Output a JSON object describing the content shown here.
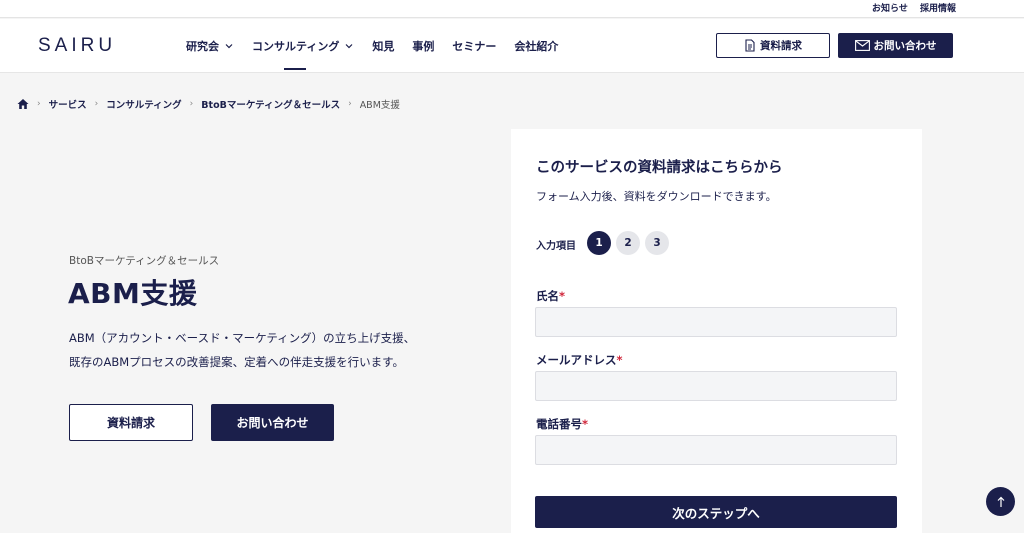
{
  "utility": {
    "news": "お知らせ",
    "recruit": "採用情報"
  },
  "header": {
    "logo": "SAIRU",
    "nav": [
      {
        "label": "研究会",
        "has_dropdown": true
      },
      {
        "label": "コンサルティング",
        "has_dropdown": true
      },
      {
        "label": "知見",
        "has_dropdown": false
      },
      {
        "label": "事例",
        "has_dropdown": false
      },
      {
        "label": "セミナー",
        "has_dropdown": false
      },
      {
        "label": "会社紹介",
        "has_dropdown": false
      }
    ],
    "doc_button": "資料請求",
    "contact_button": "お問い合わせ"
  },
  "breadcrumb": {
    "items": [
      "サービス",
      "コンサルティング",
      "BtoBマーケティング＆セールス"
    ],
    "current": "ABM支援"
  },
  "hero": {
    "category": "BtoBマーケティング＆セールス",
    "title": "ABM支援",
    "description_line1": "ABM（アカウント・ベースド・マーケティング）の立ち上げ支援、",
    "description_line2": "既存のABMプロセスの改善提案、定着への伴走支援を行います。",
    "doc_button": "資料請求",
    "contact_button": "お問い合わせ"
  },
  "form": {
    "title": "このサービスの資料請求はこちらから",
    "subtitle": "フォーム入力後、資料をダウンロードできます。",
    "steps_label": "入力項目",
    "steps": [
      "1",
      "2",
      "3"
    ],
    "current_step": 1,
    "fields": [
      {
        "label": "氏名",
        "required_mark": "*",
        "value": ""
      },
      {
        "label": "メールアドレス",
        "required_mark": "*",
        "value": ""
      },
      {
        "label": "電話番号",
        "required_mark": "*",
        "value": ""
      }
    ],
    "next_button": "次のステップへ"
  },
  "colors": {
    "brand_navy": "#1b1f4b",
    "required_red": "#d0263a",
    "page_bg": "#f5f5f5"
  },
  "icons": {
    "home": "home-icon",
    "scroll_top": "arrow-up-icon",
    "doc": "document-icon",
    "mail": "mail-icon"
  }
}
